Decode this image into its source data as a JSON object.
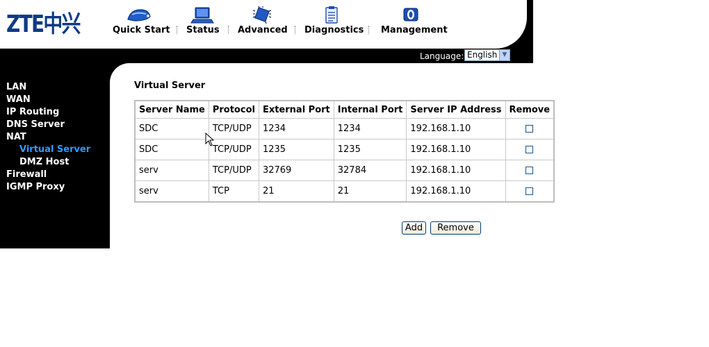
{
  "brand": {
    "logo_text": "ZTE中兴"
  },
  "top_nav": [
    {
      "label": "Quick Start",
      "icon": "quick-start-icon"
    },
    {
      "label": "Status",
      "icon": "status-monitor-icon"
    },
    {
      "label": "Advanced",
      "icon": "advanced-chip-icon"
    },
    {
      "label": "Diagnostics",
      "icon": "diagnostics-clipboard-icon"
    },
    {
      "label": "Management",
      "icon": "management-icon"
    }
  ],
  "language": {
    "label": "Language:",
    "selected": "English"
  },
  "sidebar": {
    "items": [
      {
        "label": "LAN"
      },
      {
        "label": "WAN"
      },
      {
        "label": "IP Routing"
      },
      {
        "label": "DNS Server"
      },
      {
        "label": "NAT"
      },
      {
        "label": "Virtual Server",
        "active": true
      },
      {
        "label": "DMZ Host"
      },
      {
        "label": "Firewall"
      },
      {
        "label": "IGMP Proxy"
      }
    ]
  },
  "page": {
    "title": "Virtual Server"
  },
  "table": {
    "headers": [
      "Server Name",
      "Protocol",
      "External Port",
      "Internal Port",
      "Server IP Address",
      "Remove"
    ],
    "rows": [
      [
        "SDC",
        "TCP/UDP",
        "1234",
        "1234",
        "192.168.1.10"
      ],
      [
        "SDC",
        "TCP/UDP",
        "1235",
        "1235",
        "192.168.1.10"
      ],
      [
        "serv",
        "TCP/UDP",
        "32769",
        "32784",
        "192.168.1.10"
      ],
      [
        "serv",
        "TCP",
        "21",
        "21",
        "192.168.1.10"
      ]
    ]
  },
  "actions": {
    "add_label": "Add",
    "remove_label": "Remove"
  },
  "colors": {
    "sidebar_bg": "#000000",
    "active_link": "#3399ff",
    "logo": "#0f3a86"
  }
}
